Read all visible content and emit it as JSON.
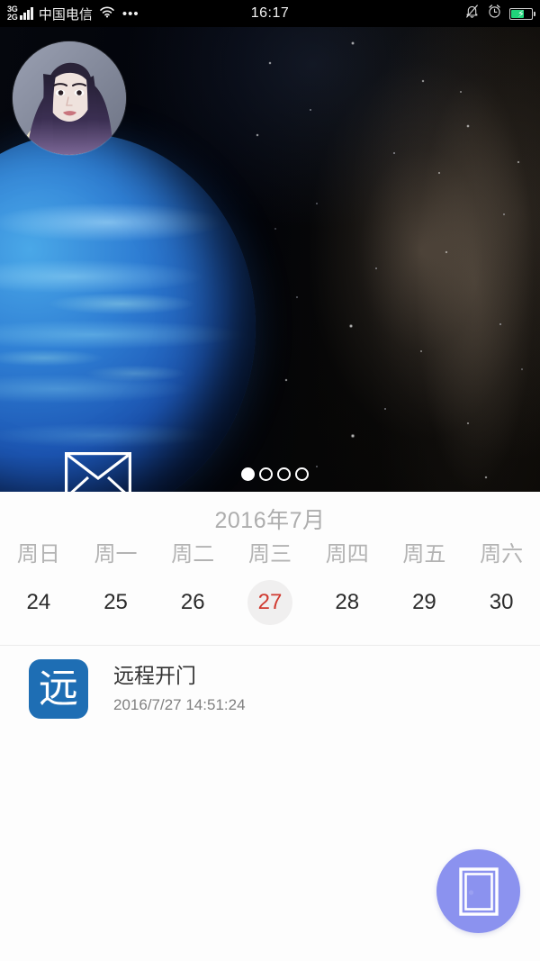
{
  "status_bar": {
    "network_gen_primary": "3G",
    "network_gen_secondary": "2G",
    "carrier": "中国电信",
    "wifi_icon": "wifi-icon",
    "more_icon": "•••",
    "time": "16:17",
    "silent_icon": "bell-muted-icon",
    "alarm_icon": "alarm-clock-icon",
    "battery_icon": "battery-charging-icon",
    "battery_level_percent": 60,
    "battery_color": "#20d47a",
    "background_color": "#000000"
  },
  "hero": {
    "avatar_alt": "user-avatar",
    "mail_icon": "envelope-icon",
    "pager": {
      "total": 4,
      "active_index": 0
    }
  },
  "calendar": {
    "month_label": "2016年7月",
    "selected_date": "27",
    "selected_color": "#d03a30",
    "days": [
      {
        "dow": "周日",
        "date": "24",
        "selected": false
      },
      {
        "dow": "周一",
        "date": "25",
        "selected": false
      },
      {
        "dow": "周二",
        "date": "26",
        "selected": false
      },
      {
        "dow": "周三",
        "date": "27",
        "selected": true
      },
      {
        "dow": "周四",
        "date": "28",
        "selected": false
      },
      {
        "dow": "周五",
        "date": "29",
        "selected": false
      },
      {
        "dow": "周六",
        "date": "30",
        "selected": false
      }
    ]
  },
  "records": [
    {
      "icon_glyph": "远",
      "icon_color": "#1e6eb4",
      "title": "远程开门",
      "timestamp": "2016/7/27 14:51:24"
    }
  ],
  "fab": {
    "icon": "door-icon",
    "color": "#8b92ef"
  }
}
